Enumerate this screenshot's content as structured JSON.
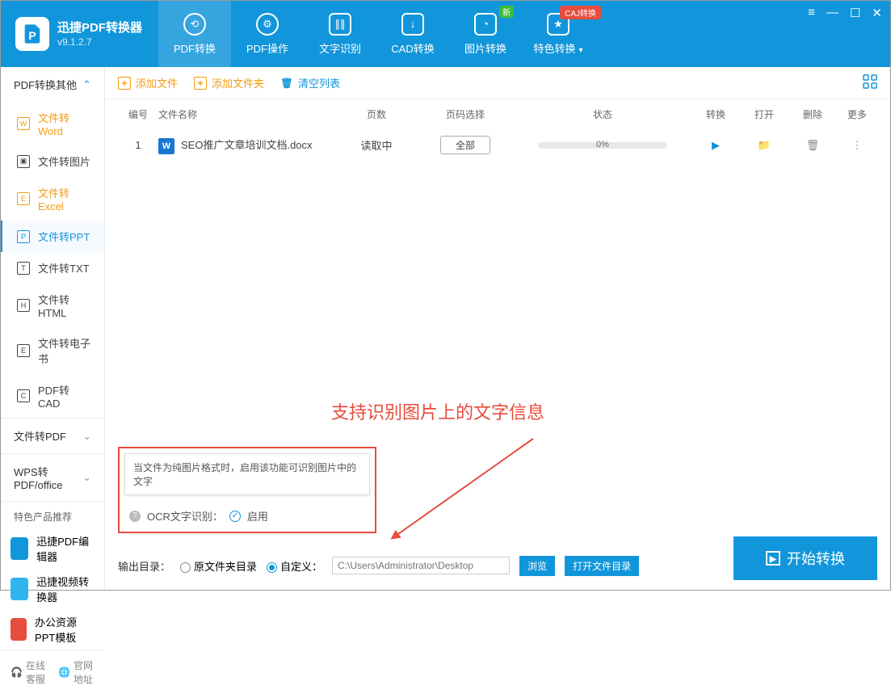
{
  "app": {
    "name": "迅捷PDF转换器",
    "version": "v9.1.2.7"
  },
  "tabs": [
    {
      "label": "PDF转换",
      "badge": null
    },
    {
      "label": "PDF操作",
      "badge": null
    },
    {
      "label": "文字识别",
      "badge": null
    },
    {
      "label": "CAD转换",
      "badge": null
    },
    {
      "label": "图片转换",
      "badge": "新"
    },
    {
      "label": "特色转换",
      "badge": "CAJ转换"
    }
  ],
  "sidebar": {
    "sections": [
      {
        "title": "PDF转换其他",
        "expanded": true
      },
      {
        "title": "文件转PDF",
        "expanded": false
      },
      {
        "title": "WPS转PDF/office",
        "expanded": false
      }
    ],
    "items": [
      {
        "label": "文件转Word",
        "letter": "W"
      },
      {
        "label": "文件转图片",
        "letter": "◫"
      },
      {
        "label": "文件转Excel",
        "letter": "E"
      },
      {
        "label": "文件转PPT",
        "letter": "P"
      },
      {
        "label": "文件转TXT",
        "letter": "T"
      },
      {
        "label": "文件转HTML",
        "letter": "H"
      },
      {
        "label": "文件转电子书",
        "letter": "E"
      },
      {
        "label": "PDF转CAD",
        "letter": "C"
      }
    ],
    "recommend_title": "特色产品推荐",
    "recommend": [
      {
        "label": "迅捷PDF编辑器"
      },
      {
        "label": "迅捷视频转换器"
      },
      {
        "label": "办公资源PPT模板"
      }
    ],
    "bottom": {
      "service": "在线客服",
      "website": "官网地址"
    }
  },
  "toolbar": {
    "add_file": "添加文件",
    "add_folder": "添加文件夹",
    "clear_list": "清空列表"
  },
  "table": {
    "headers": {
      "num": "编号",
      "name": "文件名称",
      "pages": "页数",
      "page_select": "页码选择",
      "status": "状态",
      "convert": "转换",
      "open": "打开",
      "delete": "删除",
      "more": "更多"
    },
    "rows": [
      {
        "num": "1",
        "icon": "W",
        "name": "SEO推广文章培训文档.docx",
        "pages": "读取中",
        "page_select": "全部",
        "status_percent": "0%"
      }
    ]
  },
  "annotation": {
    "text": "支持识别图片上的文字信息"
  },
  "ocr": {
    "tooltip": "当文件为纯图片格式时，启用该功能可识别图片中的文字",
    "label": "OCR文字识别：",
    "enable": "启用"
  },
  "output": {
    "label": "输出目录：",
    "option_original": "原文件夹目录",
    "option_custom": "自定义：",
    "path_placeholder": "C:\\Users\\Administrator\\Desktop",
    "browse": "浏览",
    "open_folder": "打开文件目录",
    "start": "开始转换"
  }
}
